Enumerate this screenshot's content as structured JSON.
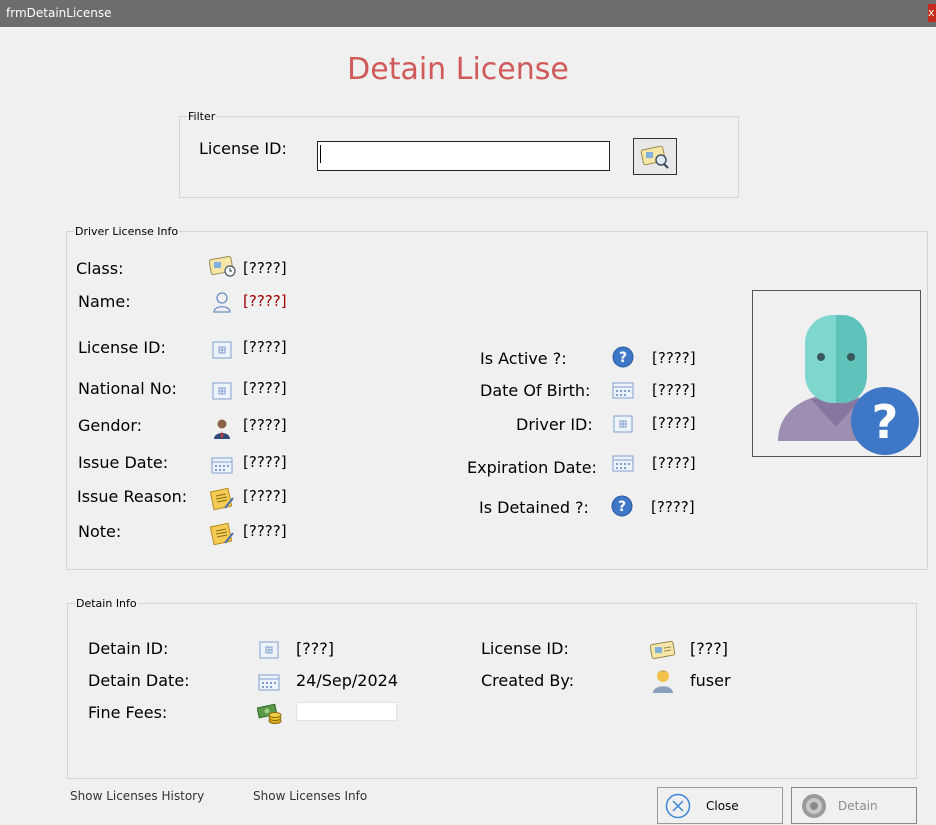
{
  "window": {
    "title": "frmDetainLicense",
    "close_glyph": "x"
  },
  "heading": "Detain License",
  "filter": {
    "group_label": "Filter",
    "license_id_label": "License ID:",
    "license_id_value": "",
    "search_icon": "license-search-icon"
  },
  "driver_info": {
    "group_label": "Driver License Info",
    "class": {
      "label": "Class:",
      "value": "[????]"
    },
    "name": {
      "label": "Name:",
      "value": "[????]"
    },
    "license_id": {
      "label": "License ID:",
      "value": "[????]"
    },
    "national_no": {
      "label": "National No:",
      "value": "[????]"
    },
    "gender": {
      "label": "Gendor:",
      "value": "[????]"
    },
    "issue_date": {
      "label": "Issue Date:",
      "value": "[????]"
    },
    "issue_reason": {
      "label": "Issue Reason:",
      "value": "[????]"
    },
    "note": {
      "label": "Note:",
      "value": "[????]"
    },
    "is_active": {
      "label": "Is Active ?:",
      "value": "[????]"
    },
    "date_of_birth": {
      "label": "Date Of Birth:",
      "value": "[????]"
    },
    "driver_id": {
      "label": "Driver ID:",
      "value": "[????]"
    },
    "expiration_date": {
      "label": "Expiration Date:",
      "value": "[????]"
    },
    "is_detained": {
      "label": "Is Detained ?:",
      "value": "[????]"
    }
  },
  "detain_info": {
    "group_label": "Detain Info",
    "detain_id": {
      "label": "Detain ID:",
      "value": "[???]"
    },
    "detain_date": {
      "label": "Detain Date:",
      "value": "24/Sep/2024"
    },
    "fine_fees": {
      "label": "Fine Fees:",
      "value": ""
    },
    "license_id": {
      "label": "License ID:",
      "value": "[???]"
    },
    "created_by": {
      "label": "Created By:",
      "value": "fuser"
    }
  },
  "links": {
    "history": "Show Licenses History",
    "info": "Show Licenses Info"
  },
  "buttons": {
    "close": "Close",
    "detain": "Detain"
  },
  "colors": {
    "heading": "#d05a5a",
    "name_value": "#a00000",
    "titlebar": "#6d6d6d",
    "question_badge": "#3f77c7"
  }
}
